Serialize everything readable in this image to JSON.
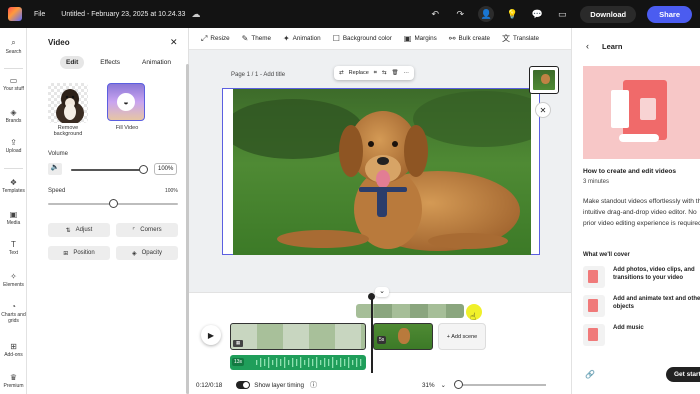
{
  "topbar": {
    "file_label": "File",
    "doc_title": "Untitled - February 23, 2025 at 10.24.33",
    "download_label": "Download",
    "share_label": "Share"
  },
  "rail": {
    "items": [
      {
        "label": "Search",
        "icon": "search-icon"
      },
      {
        "label": "Your stuff",
        "icon": "folder-icon"
      },
      {
        "label": "Brands",
        "icon": "brand-icon"
      },
      {
        "label": "Upload",
        "icon": "upload-icon"
      },
      {
        "label": "Templates",
        "icon": "templates-icon"
      },
      {
        "label": "Media",
        "icon": "media-icon"
      },
      {
        "label": "Text",
        "icon": "text-icon"
      },
      {
        "label": "Elements",
        "icon": "elements-icon"
      },
      {
        "label": "Charts and grids",
        "icon": "charts-icon"
      },
      {
        "label": "Add-ons",
        "icon": "addons-icon"
      },
      {
        "label": "Premium",
        "icon": "premium-icon"
      }
    ]
  },
  "panel": {
    "title": "Video",
    "tabs": [
      "Edit",
      "Effects",
      "Animation"
    ],
    "thumb1_label": "Remove background",
    "thumb2_label": "Fill Video",
    "volume_label": "Volume",
    "volume_value": "100%",
    "volume_level": 1.0,
    "speed_label": "Speed",
    "speed_value": "100%",
    "speed_level": 0.5,
    "buttons": [
      "Adjust",
      "Corners",
      "Position",
      "Opacity"
    ]
  },
  "toolbar": {
    "items": [
      "Resize",
      "Theme",
      "Animation",
      "Background color",
      "Margins",
      "Bulk create",
      "Translate"
    ]
  },
  "canvas": {
    "page_label": "Page 1 / 1 - Add title",
    "replace_label": "Replace"
  },
  "timeline": {
    "time": "0:12/0:18",
    "show_layer_timing": "Show layer timing",
    "zoom": "31%",
    "add_scene": "+ Add scene",
    "scene_badge": "5s",
    "audio_badge": "13s"
  },
  "learn": {
    "title": "Learn",
    "article_title": "How to create and edit videos",
    "duration": "3 minutes",
    "description": "Make standout videos effortlessly with the intuitive drag-and-drop video editor. No prior video editing experience is required.",
    "cover_heading": "What we'll cover",
    "cover_items": [
      "Add photos, video clips, and transitions to your video",
      "Add and animate text and other objects",
      "Add music"
    ],
    "get_started": "Get started"
  }
}
